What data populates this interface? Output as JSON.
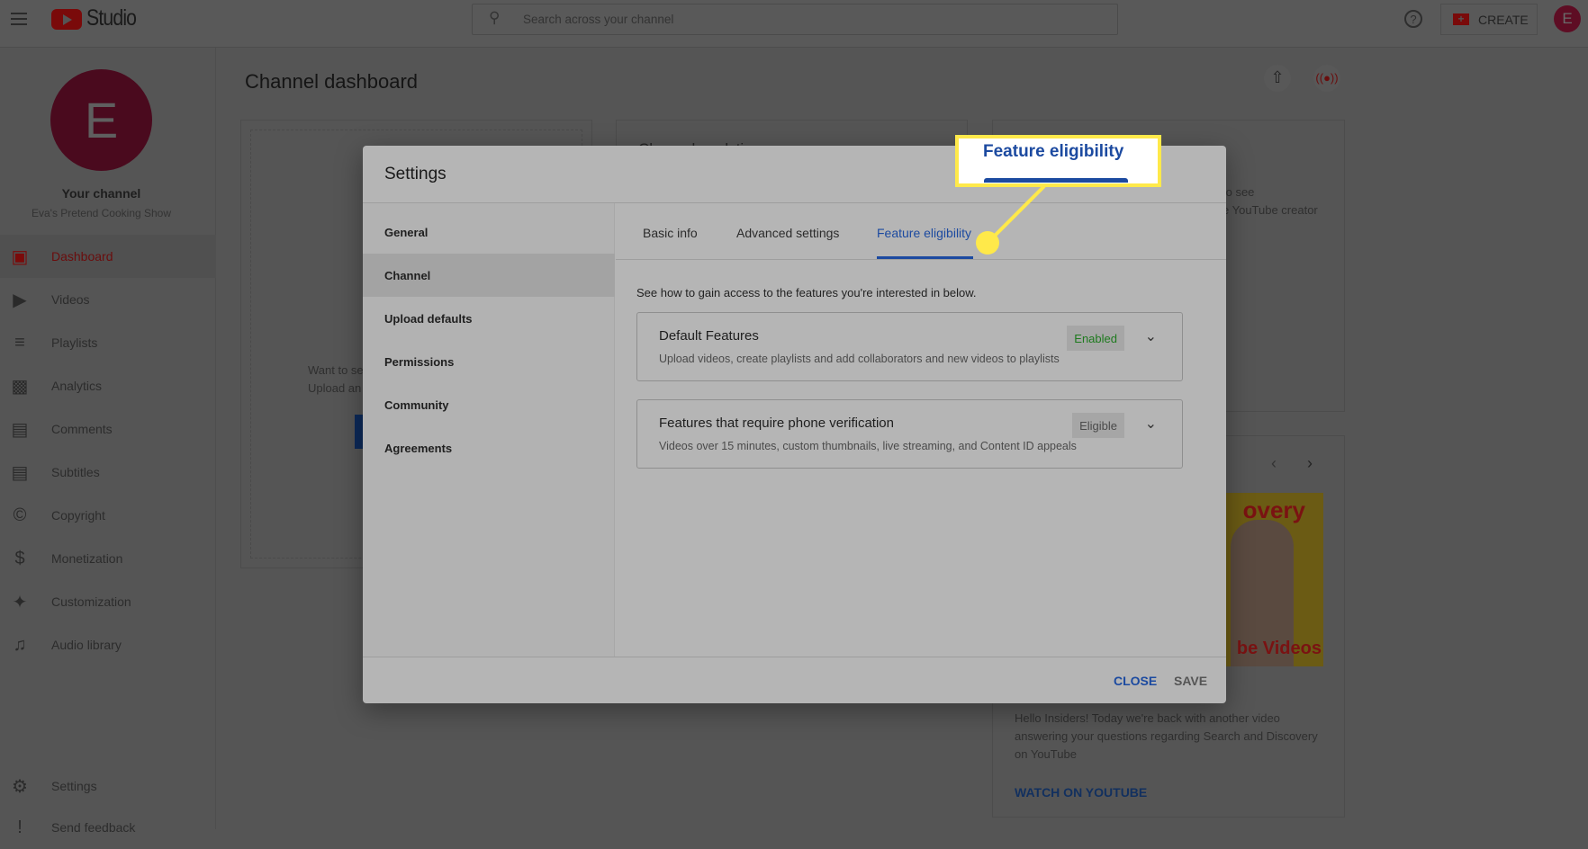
{
  "topbar": {
    "app_name": "Studio",
    "search_placeholder": "Search across your channel",
    "create_label": "CREATE",
    "avatar_letter": "E"
  },
  "sidebar": {
    "avatar_letter": "E",
    "channel_label": "Your channel",
    "channel_name": "Eva's Pretend Cooking Show",
    "items": [
      {
        "label": "Dashboard",
        "icon": "dashboard-icon"
      },
      {
        "label": "Videos",
        "icon": "videos-icon"
      },
      {
        "label": "Playlists",
        "icon": "playlists-icon"
      },
      {
        "label": "Analytics",
        "icon": "analytics-icon"
      },
      {
        "label": "Comments",
        "icon": "comments-icon"
      },
      {
        "label": "Subtitles",
        "icon": "subtitles-icon"
      },
      {
        "label": "Copyright",
        "icon": "copyright-icon"
      },
      {
        "label": "Monetization",
        "icon": "monetization-icon"
      },
      {
        "label": "Customization",
        "icon": "customization-icon"
      },
      {
        "label": "Audio library",
        "icon": "audio-library-icon"
      }
    ],
    "settings_label": "Settings",
    "feedback_label": "Send feedback"
  },
  "main": {
    "title": "Channel dashboard",
    "left_card_line1": "Want to se",
    "left_card_line2": "Upload an",
    "middle_card_title": "Channel analytics",
    "right_card_line1": "to see",
    "right_card_line2": "e YouTube creator",
    "news": {
      "thumb_top": "overy",
      "thumb_bottom": "be Videos",
      "description": "Hello Insiders! Today we're back with another video answering your questions regarding Search and Discovery on YouTube",
      "watch_label": "WATCH ON YOUTUBE"
    }
  },
  "dialog": {
    "title": "Settings",
    "nav": [
      "General",
      "Channel",
      "Upload defaults",
      "Permissions",
      "Community",
      "Agreements"
    ],
    "selected_nav": "Channel",
    "tabs": [
      "Basic info",
      "Advanced settings",
      "Feature eligibility"
    ],
    "active_tab": "Feature eligibility",
    "intro": "See how to gain access to the features you're interested in below.",
    "features": [
      {
        "title": "Default Features",
        "description": "Upload videos, create playlists and add collaborators and new videos to playlists",
        "status": "Enabled",
        "status_color": "#1e7a1e"
      },
      {
        "title": "Features that require phone verification",
        "description": "Videos over 15 minutes, custom thumbnails, live streaming, and Content ID appeals",
        "status": "Eligible",
        "status_color": "#4a4a4a"
      }
    ],
    "close_label": "CLOSE",
    "save_label": "SAVE"
  },
  "callout": {
    "label": "Feature eligibility",
    "color": "#ffe94a"
  },
  "colors": {
    "accent_blue": "#1c4aa0",
    "brand_red": "#7a0a0a"
  }
}
